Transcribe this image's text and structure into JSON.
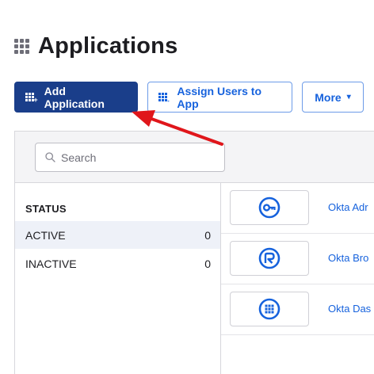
{
  "header": {
    "title": "Applications",
    "icon": "apps-grid-icon"
  },
  "toolbar": {
    "add_label": "Add Application",
    "assign_label": "Assign Users to App",
    "more_label": "More",
    "more_caret": "▾"
  },
  "search": {
    "placeholder": "Search",
    "value": ""
  },
  "sidebar": {
    "heading": "STATUS",
    "filters": [
      {
        "label": "ACTIVE",
        "count": "0",
        "selected": true
      },
      {
        "label": "INACTIVE",
        "count": "0",
        "selected": false
      }
    ]
  },
  "apps": [
    {
      "name": "Okta Adr",
      "icon": "okta-key-icon"
    },
    {
      "name": "Okta Bro",
      "icon": "okta-browser-plugin-icon"
    },
    {
      "name": "Okta Das",
      "icon": "okta-dashboard-icon"
    }
  ],
  "colors": {
    "primary": "#1a3e8a",
    "link": "#1662dd",
    "icon_blue": "#1662dd",
    "annotation_arrow": "#e0161b"
  }
}
